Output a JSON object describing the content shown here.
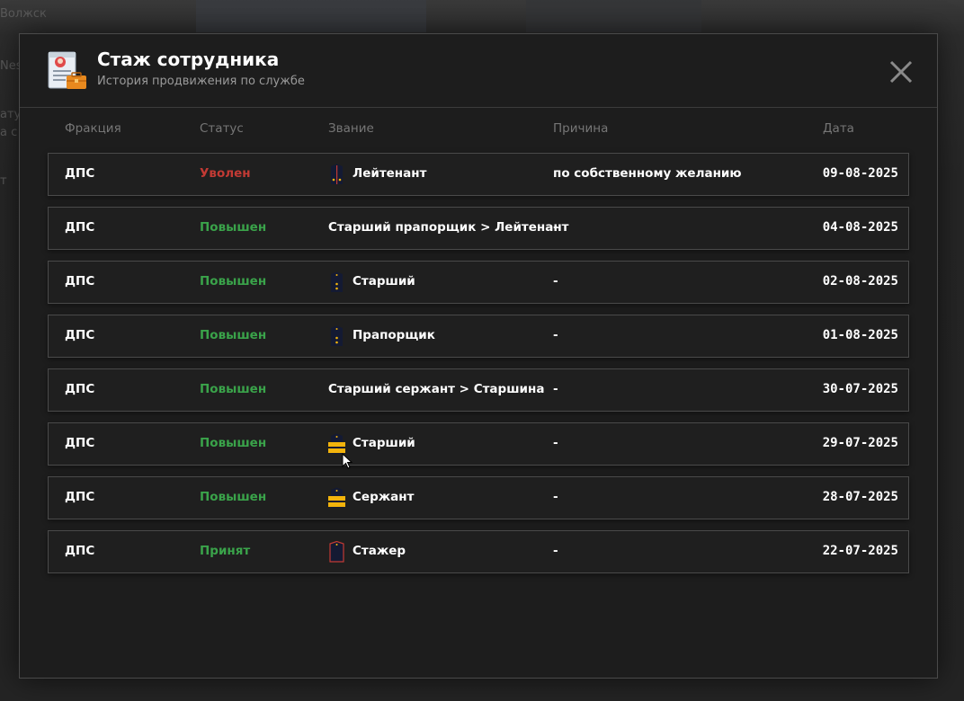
{
  "background": {
    "fragments": [
      "Волжск",
      "Nes",
      "атус",
      "а с",
      "т"
    ]
  },
  "modal": {
    "title": "Стаж сотрудника",
    "subtitle": "История продвижения по службе",
    "close_icon": "close-icon",
    "header_icon": "employee-record-icon"
  },
  "columns": {
    "faction": "Фракция",
    "status": "Статус",
    "rank": "Звание",
    "reason": "Причина",
    "date": "Дата"
  },
  "colors": {
    "fired": "#c23a34",
    "promoted": "#3aa34a",
    "accepted": "#3aa34a",
    "rank_gold": "#f2b30c",
    "rank_navy": "#141a33"
  },
  "rows": [
    {
      "faction": "ДПС",
      "status": "Уволен",
      "status_type": "fired",
      "rank_icon": "lieutenant-shoulder-board-icon",
      "rank": "Лейтенант",
      "reason": "по собственному желанию",
      "date": "09-08-2025"
    },
    {
      "faction": "ДПС",
      "status": "Повышен",
      "status_type": "promoted",
      "rank_icon": "",
      "rank": "Старший прапорщик > Лейтенант",
      "reason": "-",
      "date": "04-08-2025"
    },
    {
      "faction": "ДПС",
      "status": "Повышен",
      "status_type": "promoted",
      "rank_icon": "senior-warrant-shoulder-board-icon",
      "rank": "Старший",
      "reason": "-",
      "date": "02-08-2025"
    },
    {
      "faction": "ДПС",
      "status": "Повышен",
      "status_type": "promoted",
      "rank_icon": "warrant-shoulder-board-icon",
      "rank": "Прапорщик",
      "reason": "-",
      "date": "01-08-2025"
    },
    {
      "faction": "ДПС",
      "status": "Повышен",
      "status_type": "promoted",
      "rank_icon": "",
      "rank": "Старший сержант > Старшина",
      "reason": "-",
      "date": "30-07-2025"
    },
    {
      "faction": "ДПС",
      "status": "Повышен",
      "status_type": "promoted",
      "rank_icon": "senior-sergeant-shoulder-board-icon",
      "rank": "Старший",
      "reason": "-",
      "date": "29-07-2025"
    },
    {
      "faction": "ДПС",
      "status": "Повышен",
      "status_type": "promoted",
      "rank_icon": "sergeant-shoulder-board-icon",
      "rank": "Сержант",
      "reason": "-",
      "date": "28-07-2025"
    },
    {
      "faction": "ДПС",
      "status": "Принят",
      "status_type": "accepted",
      "rank_icon": "trainee-shoulder-board-icon",
      "rank": "Стажер",
      "reason": "-",
      "date": "22-07-2025"
    }
  ]
}
